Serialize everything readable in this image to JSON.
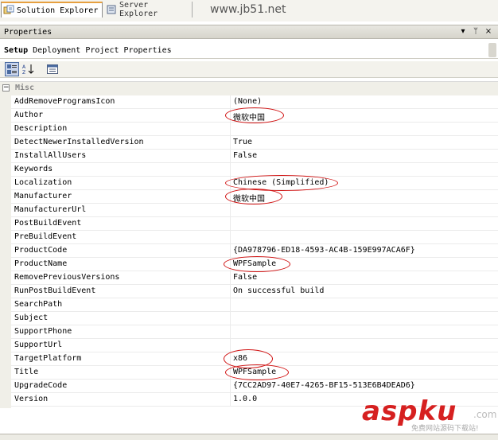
{
  "tabs": {
    "solution_explorer": "Solution Explorer",
    "server_explorer": "Server Explorer"
  },
  "watermark_url": "www.jb51.net",
  "panel": {
    "title": "Properties",
    "dropdown_glyph": "▾",
    "pin_glyph": "ᛘ",
    "close_glyph": "×"
  },
  "selector": {
    "name": "Setup",
    "type": "Deployment Project Properties"
  },
  "category": {
    "toggle": "−",
    "label": "Misc"
  },
  "properties": [
    {
      "name": "AddRemoveProgramsIcon",
      "value": "(None)"
    },
    {
      "name": "Author",
      "value": "微软中国"
    },
    {
      "name": "Description",
      "value": ""
    },
    {
      "name": "DetectNewerInstalledVersion",
      "value": "True"
    },
    {
      "name": "InstallAllUsers",
      "value": "False"
    },
    {
      "name": "Keywords",
      "value": ""
    },
    {
      "name": "Localization",
      "value": "Chinese (Simplified)"
    },
    {
      "name": "Manufacturer",
      "value": "微软中国"
    },
    {
      "name": "ManufacturerUrl",
      "value": ""
    },
    {
      "name": "PostBuildEvent",
      "value": ""
    },
    {
      "name": "PreBuildEvent",
      "value": ""
    },
    {
      "name": "ProductCode",
      "value": "{DA978796-ED18-4593-AC4B-159E997ACA6F}"
    },
    {
      "name": "ProductName",
      "value": "WPFSample"
    },
    {
      "name": "RemovePreviousVersions",
      "value": "False"
    },
    {
      "name": "RunPostBuildEvent",
      "value": "On successful build"
    },
    {
      "name": "SearchPath",
      "value": ""
    },
    {
      "name": "Subject",
      "value": ""
    },
    {
      "name": "SupportPhone",
      "value": ""
    },
    {
      "name": "SupportUrl",
      "value": ""
    },
    {
      "name": "TargetPlatform",
      "value": "x86"
    },
    {
      "name": "Title",
      "value": "WPFSample"
    },
    {
      "name": "UpgradeCode",
      "value": "{7CC2AD97-40E7-4265-BF15-513E6B4DEAD6}"
    },
    {
      "name": "Version",
      "value": "1.0.0"
    }
  ],
  "highlighted_properties": [
    "Author",
    "Localization",
    "Manufacturer",
    "ProductName",
    "TargetPlatform",
    "Title"
  ],
  "logo": {
    "main": "aspku",
    "com": ".com",
    "sub": "免费网站源码下载站!"
  },
  "colors": {
    "highlight_circle": "#d01010",
    "logo_red": "#d62020",
    "tab_accent": "#e6a040"
  }
}
